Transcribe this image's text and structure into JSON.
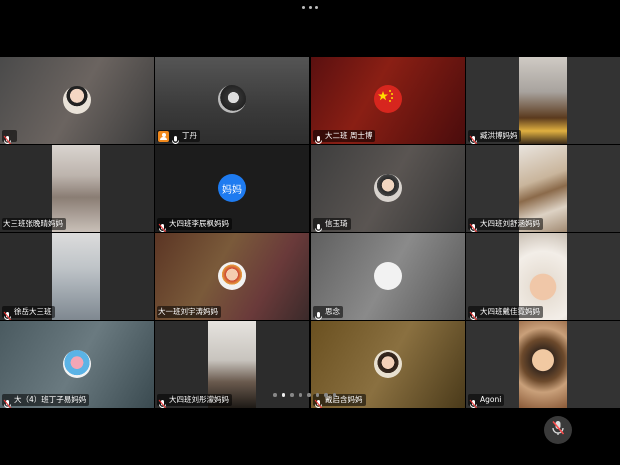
{
  "participants": [
    {
      "name": "",
      "muted": true
    },
    {
      "name": "丁丹",
      "muted": false,
      "host": true
    },
    {
      "name": "大二班 周士博",
      "muted": false
    },
    {
      "name": "臧洪博妈妈",
      "muted": true
    },
    {
      "name": "大三班张晚晴妈妈",
      "muted": true
    },
    {
      "name": "大四班李辰枫妈妈",
      "muted": true,
      "avatar_text": "妈妈"
    },
    {
      "name": "信玉琦",
      "muted": true
    },
    {
      "name": "大四班刘舒涵妈妈",
      "muted": true
    },
    {
      "name": "徐岳大三班",
      "muted": true
    },
    {
      "name": "大一班刘宇涛妈妈",
      "muted": true
    },
    {
      "name": "思念",
      "muted": false
    },
    {
      "name": "大四班戴佳霓妈妈",
      "muted": true
    },
    {
      "name": "大（4）班丁子易妈妈",
      "muted": true
    },
    {
      "name": "大四班刘彤濛妈妈",
      "muted": true
    },
    {
      "name": "戴启含妈妈",
      "muted": true
    },
    {
      "name": "Agoni",
      "muted": true
    }
  ],
  "pager": {
    "pages": 8,
    "current": 2
  },
  "colors": {
    "speaking_border": "#2fbf6e",
    "host_badge": "#f28a1d",
    "text_avatar": "#1e7bf0"
  }
}
